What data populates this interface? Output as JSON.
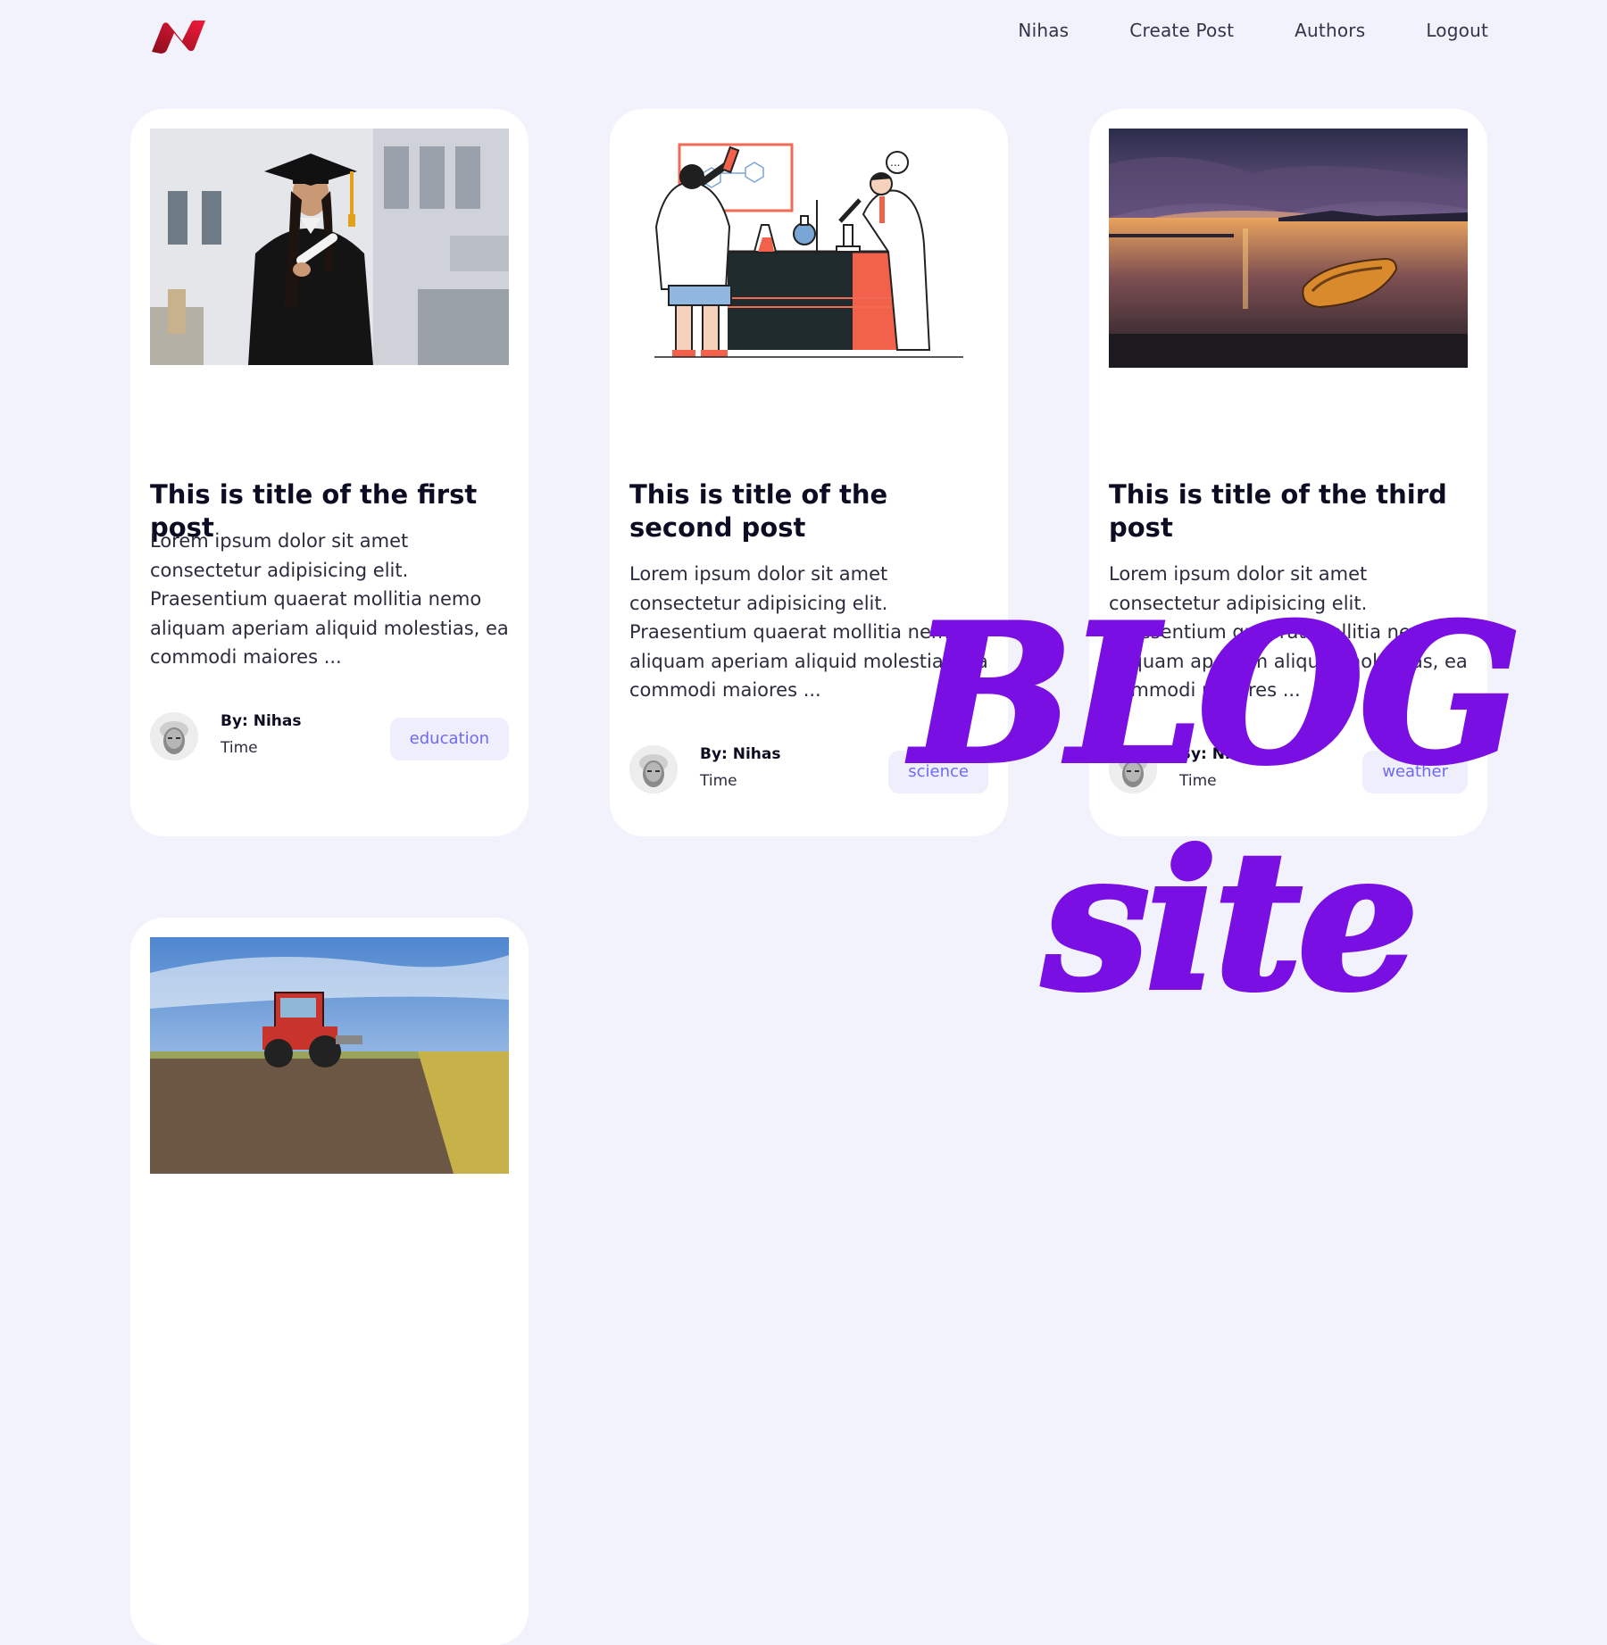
{
  "nav": {
    "logo": "logo-icon",
    "links": [
      "Nihas",
      "Create Post",
      "Authors",
      "Logout"
    ]
  },
  "posts": [
    {
      "title": "This is title of the first post",
      "excerpt": "Lorem ipsum dolor sit amet consectetur adipisicing elit. Praesentium quaerat mollitia nemo aliquam aperiam aliquid molestias, ea commodi maiores ...",
      "author": "By: Nihas",
      "time": "Time",
      "category": "education",
      "thumbnail": "graduate-photo"
    },
    {
      "title": "This is title of the second post",
      "excerpt": "Lorem ipsum dolor sit amet consectetur adipisicing elit. Praesentium quaerat mollitia nemo aliquam aperiam aliquid molestias, ea commodi maiores ...",
      "author": "By: Nihas",
      "time": "Time",
      "category": "science",
      "thumbnail": "science-lab-illustration"
    },
    {
      "title": "This is title of the third post",
      "excerpt": "Lorem ipsum dolor sit amet consectetur adipisicing elit. Praesentium quaerat mollitia nemo aliquam aperiam aliquid molestias, ea commodi maiores ...",
      "author": "By: Nihas",
      "time": "Time",
      "category": "weather",
      "thumbnail": "sunset-lake-photo"
    },
    {
      "thumbnail": "tractor-field-photo"
    }
  ],
  "overlay": {
    "line1": "BLOG",
    "line2": "site",
    "color": "#7a0fe3"
  },
  "colors": {
    "background": "#f2f2fd",
    "card": "#ffffff",
    "accent": "#6f6af0",
    "badge_bg": "#eeeefd"
  }
}
